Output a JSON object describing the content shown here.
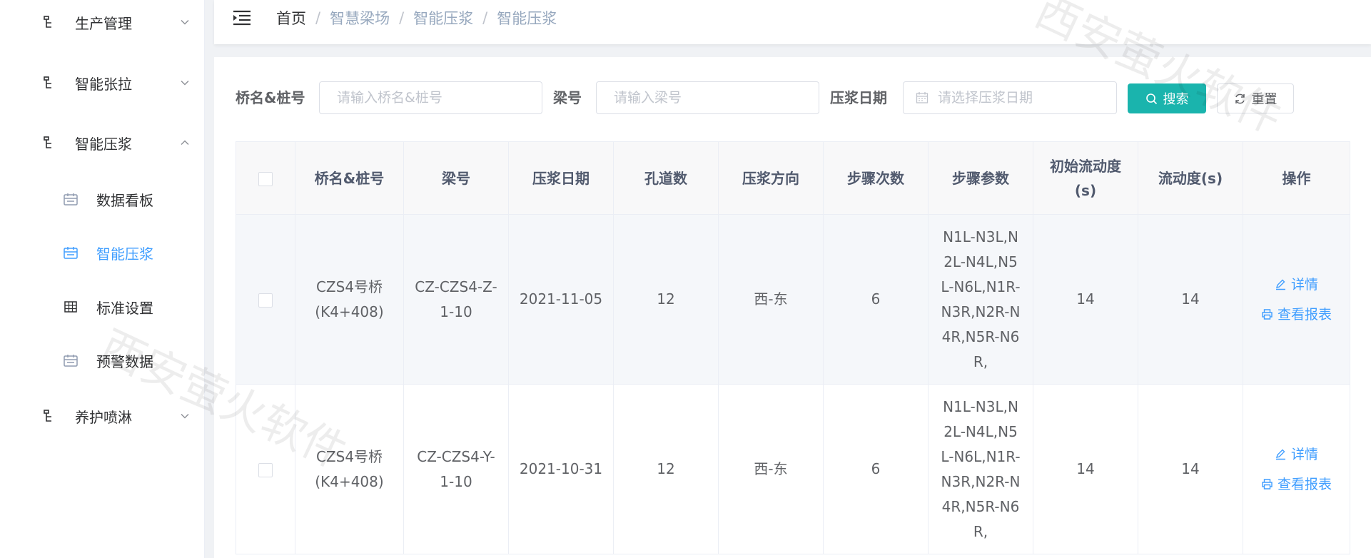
{
  "sidebar": {
    "items": [
      {
        "label": "生产管理",
        "icon": "tree-icon",
        "expanded": false
      },
      {
        "label": "智能张拉",
        "icon": "tree-icon",
        "expanded": false
      },
      {
        "label": "智能压浆",
        "icon": "tree-icon",
        "expanded": true
      },
      {
        "label": "养护喷淋",
        "icon": "tree-icon",
        "expanded": false
      }
    ],
    "subitems": [
      {
        "label": "数据看板",
        "icon": "calendar-icon"
      },
      {
        "label": "智能压浆",
        "icon": "calendar-icon",
        "active": true
      },
      {
        "label": "标准设置",
        "icon": "table-icon"
      },
      {
        "label": "预警数据",
        "icon": "calendar-icon"
      }
    ]
  },
  "breadcrumb": [
    "首页",
    "智慧梁场",
    "智能压浆",
    "智能压浆"
  ],
  "search": {
    "bridge_label": "桥名&桩号",
    "bridge_placeholder": "请输入桥名&桩号",
    "beam_label": "梁号",
    "beam_placeholder": "请输入梁号",
    "date_label": "压浆日期",
    "date_placeholder": "请选择压浆日期",
    "search_button": "搜索",
    "reset_button": "重置"
  },
  "table": {
    "headers": [
      "桥名&桩号",
      "梁号",
      "压浆日期",
      "孔道数",
      "压浆方向",
      "步骤次数",
      "步骤参数",
      "初始流动度(s)",
      "流动度(s)",
      "操作"
    ],
    "rows": [
      {
        "bridge": "CZS4号桥(K4+408)",
        "beam": "CZ-CZS4-Z-1-10",
        "date": "2021-11-05",
        "holes": "12",
        "direction": "西-东",
        "steps": "6",
        "params": "N1L-N3L,N2L-N4L,N5L-N6L,N1R-N3R,N2R-N4R,N5R-N6R,",
        "init_flow": "14",
        "flow": "14",
        "detail": "详情",
        "report": "查看报表"
      },
      {
        "bridge": "CZS4号桥(K4+408)",
        "beam": "CZ-CZS4-Y-1-10",
        "date": "2021-10-31",
        "holes": "12",
        "direction": "西-东",
        "steps": "6",
        "params": "N1L-N3L,N2L-N4L,N5L-N6L,N1R-N3R,N2R-N4R,N5R-N6R,",
        "init_flow": "14",
        "flow": "14",
        "detail": "详情",
        "report": "查看报表"
      }
    ]
  },
  "colors": {
    "primary": "#1ab4ad",
    "link": "#409eff",
    "active_menu": "#409eff"
  },
  "watermark": "西安萤火软件"
}
